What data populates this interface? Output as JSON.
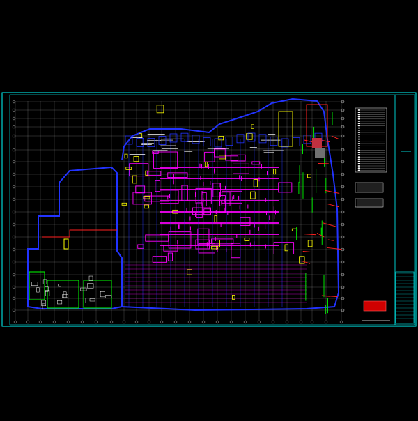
{
  "drawing": {
    "background": "#000000",
    "colors": {
      "frame": "#00ffff",
      "grid": "#ffffff",
      "outline": "#2233ff",
      "wall": "#ff00ff",
      "equipment": "#ffff00",
      "pipe_red": "#ff2020",
      "pipe_green": "#00ff00",
      "white": "#ffffff",
      "legend_box": "#e00000"
    },
    "icons": [
      "drawing-frame",
      "column-grid",
      "building-outline",
      "title-block",
      "legend-table",
      "legend-stamp"
    ]
  }
}
